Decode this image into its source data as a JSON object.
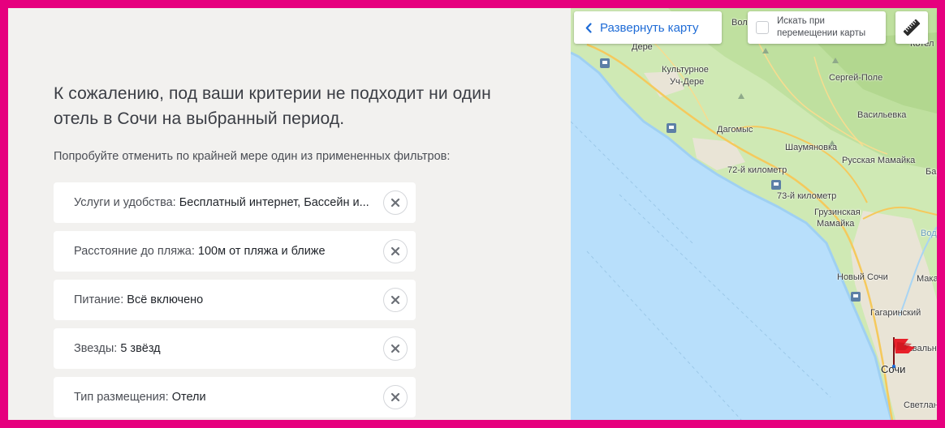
{
  "no_results": {
    "headline": "К сожалению, под ваши критерии не подходит ни один отель в Сочи на выбранный период.",
    "hint": "Попробуйте отменить по крайней мере один из примененных фильтров:"
  },
  "filters": [
    {
      "label": "Услуги и удобства: ",
      "value": "Бесплатный интернет, Бассейн и..."
    },
    {
      "label": "Расстояние до пляжа: ",
      "value": "100м от пляжа и ближе"
    },
    {
      "label": "Питание: ",
      "value": "Всё включено"
    },
    {
      "label": "Звезды: ",
      "value": "5 звёзд"
    },
    {
      "label": "Тип размещения: ",
      "value": "Отели"
    }
  ],
  "map": {
    "expand_label": "Развернуть карту",
    "search_on_move": "Искать при перемещении карты",
    "labels": {
      "vol": "Вол",
      "dere": "Дере",
      "kultur1": "Культурное",
      "kultur2": "Уч-Дере",
      "dagomys": "Дагомыс",
      "sergey": "Сергей-Поле",
      "vasil": "Васильевка",
      "shaum": "Шаумяновка",
      "russ": "Русская Мамайка",
      "km72": "72-й километр",
      "km73": "73-й километр",
      "gruz1": "Грузинская",
      "gruz2": "Мамайка",
      "novy": "Новый Сочи",
      "gagar": "Гагаринский",
      "sochi": "Сочи",
      "zav": "Завальны",
      "svet": "Светлана",
      "makar": "Макар",
      "bar": "Бара",
      "vodok": "Водок",
      "kotel": "Котел"
    },
    "colors": {
      "sea": "#b8dffb",
      "land": "#cfe9b4",
      "urban": "#e9e4d6",
      "road": "#f5c95c",
      "accent": "#1e6bd6",
      "marker": "#e8202a"
    }
  }
}
